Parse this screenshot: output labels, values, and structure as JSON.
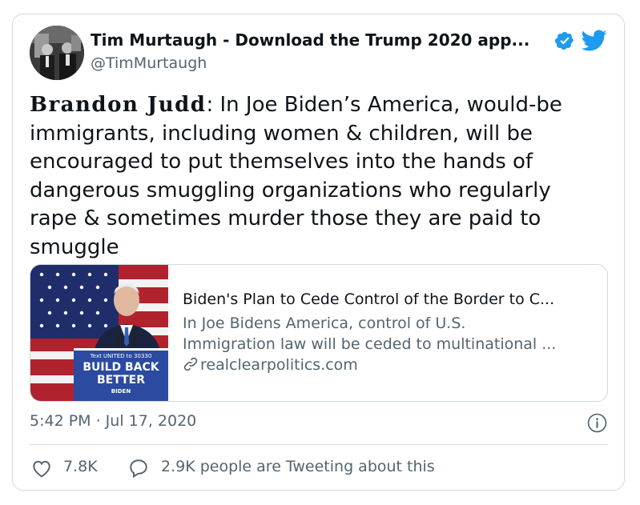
{
  "tweet": {
    "display_name": "Tim Murtaugh - Download the Trump 2020 app...",
    "handle": "@TimMurtaugh",
    "text_author": "Brandon Judd",
    "text_body": ": In Joe Biden’s America, would-be immigrants, including women & children, will be encouraged to put themselves into the hands of dangerous smuggling organizations who regularly rape & sometimes murder those they are paid to smuggle",
    "timestamp": "5:42 PM · Jul 17, 2020",
    "likes": "7.8K",
    "replies": "2.9K people are Tweeting about this"
  },
  "link_card": {
    "title": "Biden's Plan to Cede Control of the Border to C...",
    "description_line1": "In Joe Bidens America, control of U.S.",
    "description_line2": "Immigration law will be ceded to multinational ...",
    "domain": "realclearpolitics.com",
    "thumbnail_podium_small": "Text UNITED to 30330",
    "thumbnail_podium_line1": "BUILD BACK",
    "thumbnail_podium_line2": "BETTER",
    "thumbnail_podium_logo": "BIDEN"
  },
  "colors": {
    "twitter_blue": "#1d9bf0",
    "text_primary": "#0f1419",
    "text_secondary": "#536471",
    "border": "#cfd9de"
  },
  "icons": [
    "verified-badge-icon",
    "twitter-bird-icon",
    "link-icon",
    "info-icon",
    "heart-icon",
    "reply-bubble-icon"
  ]
}
